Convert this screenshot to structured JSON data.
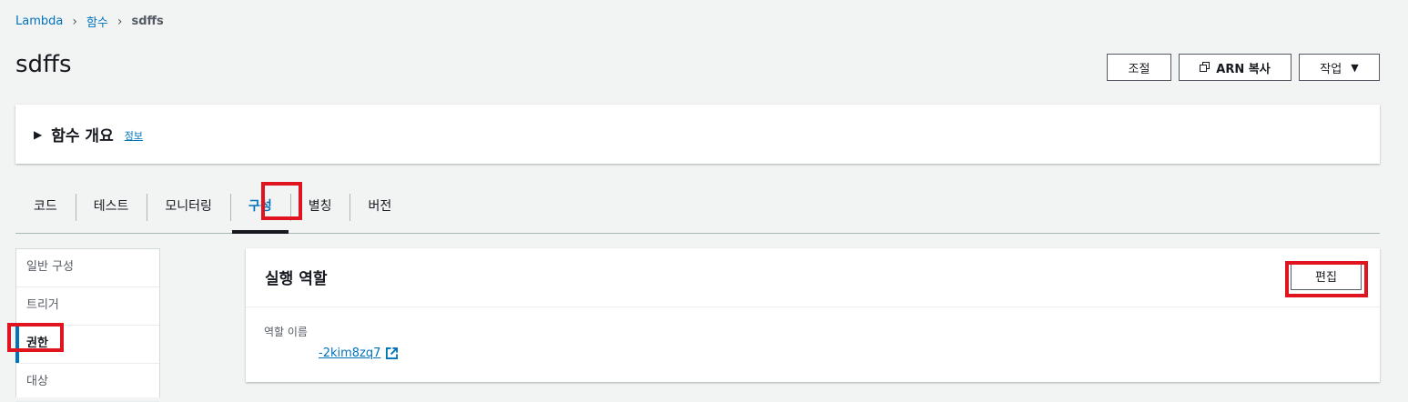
{
  "breadcrumb": {
    "root": "Lambda",
    "functions": "함수",
    "current": "sdffs"
  },
  "page": {
    "title": "sdffs"
  },
  "header_actions": {
    "adjust": "조절",
    "copy_arn": "ARN 복사",
    "actions": "작업"
  },
  "overview": {
    "title": "함수 개요",
    "info": "정보"
  },
  "tabs": [
    {
      "label": "코드"
    },
    {
      "label": "테스트"
    },
    {
      "label": "모니터링"
    },
    {
      "label": "구성",
      "active": true
    },
    {
      "label": "별칭"
    },
    {
      "label": "버전"
    }
  ],
  "config_nav": [
    {
      "label": "일반 구성"
    },
    {
      "label": "트리거"
    },
    {
      "label": "권한",
      "active": true
    },
    {
      "label": "대상"
    }
  ],
  "execution_role": {
    "title": "실행 역할",
    "edit": "편집",
    "role_name_label": "역할 이름",
    "role_name_value": "-2kim8zq7"
  },
  "colors": {
    "link": "#0073bb",
    "highlight": "#e0141e",
    "background": "#f2f3f3"
  },
  "icons": [
    "chevron-right-icon",
    "copy-icon",
    "caret-down-icon",
    "triangle-right-icon",
    "external-link-icon"
  ]
}
